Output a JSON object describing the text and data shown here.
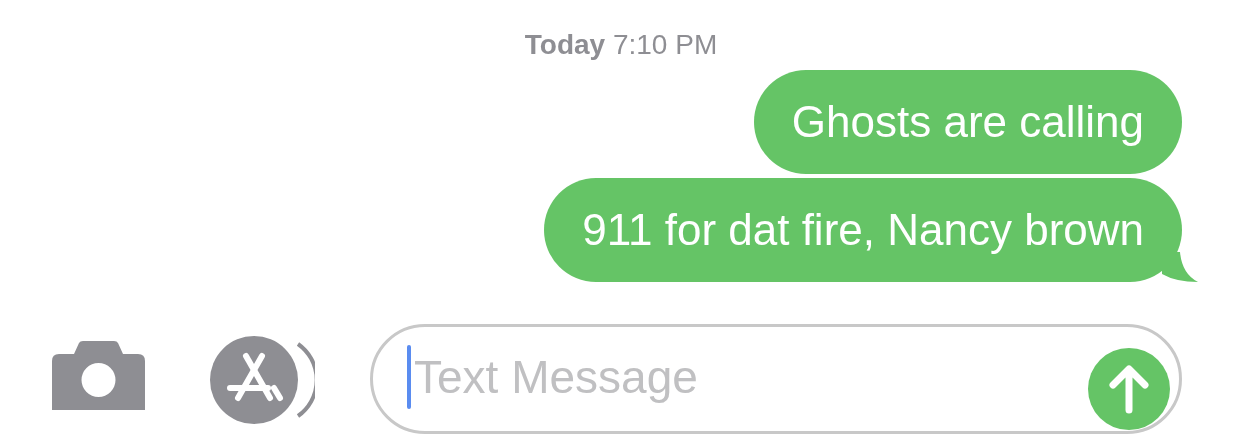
{
  "timestamp": {
    "day": "Today",
    "time": "7:10 PM"
  },
  "messages": [
    {
      "text": "Ghosts are calling",
      "kind": "sent",
      "tail": false
    },
    {
      "text": "911 for dat fire, Nancy brown",
      "kind": "sent",
      "tail": true
    }
  ],
  "composer": {
    "placeholder": "Text Message"
  }
}
